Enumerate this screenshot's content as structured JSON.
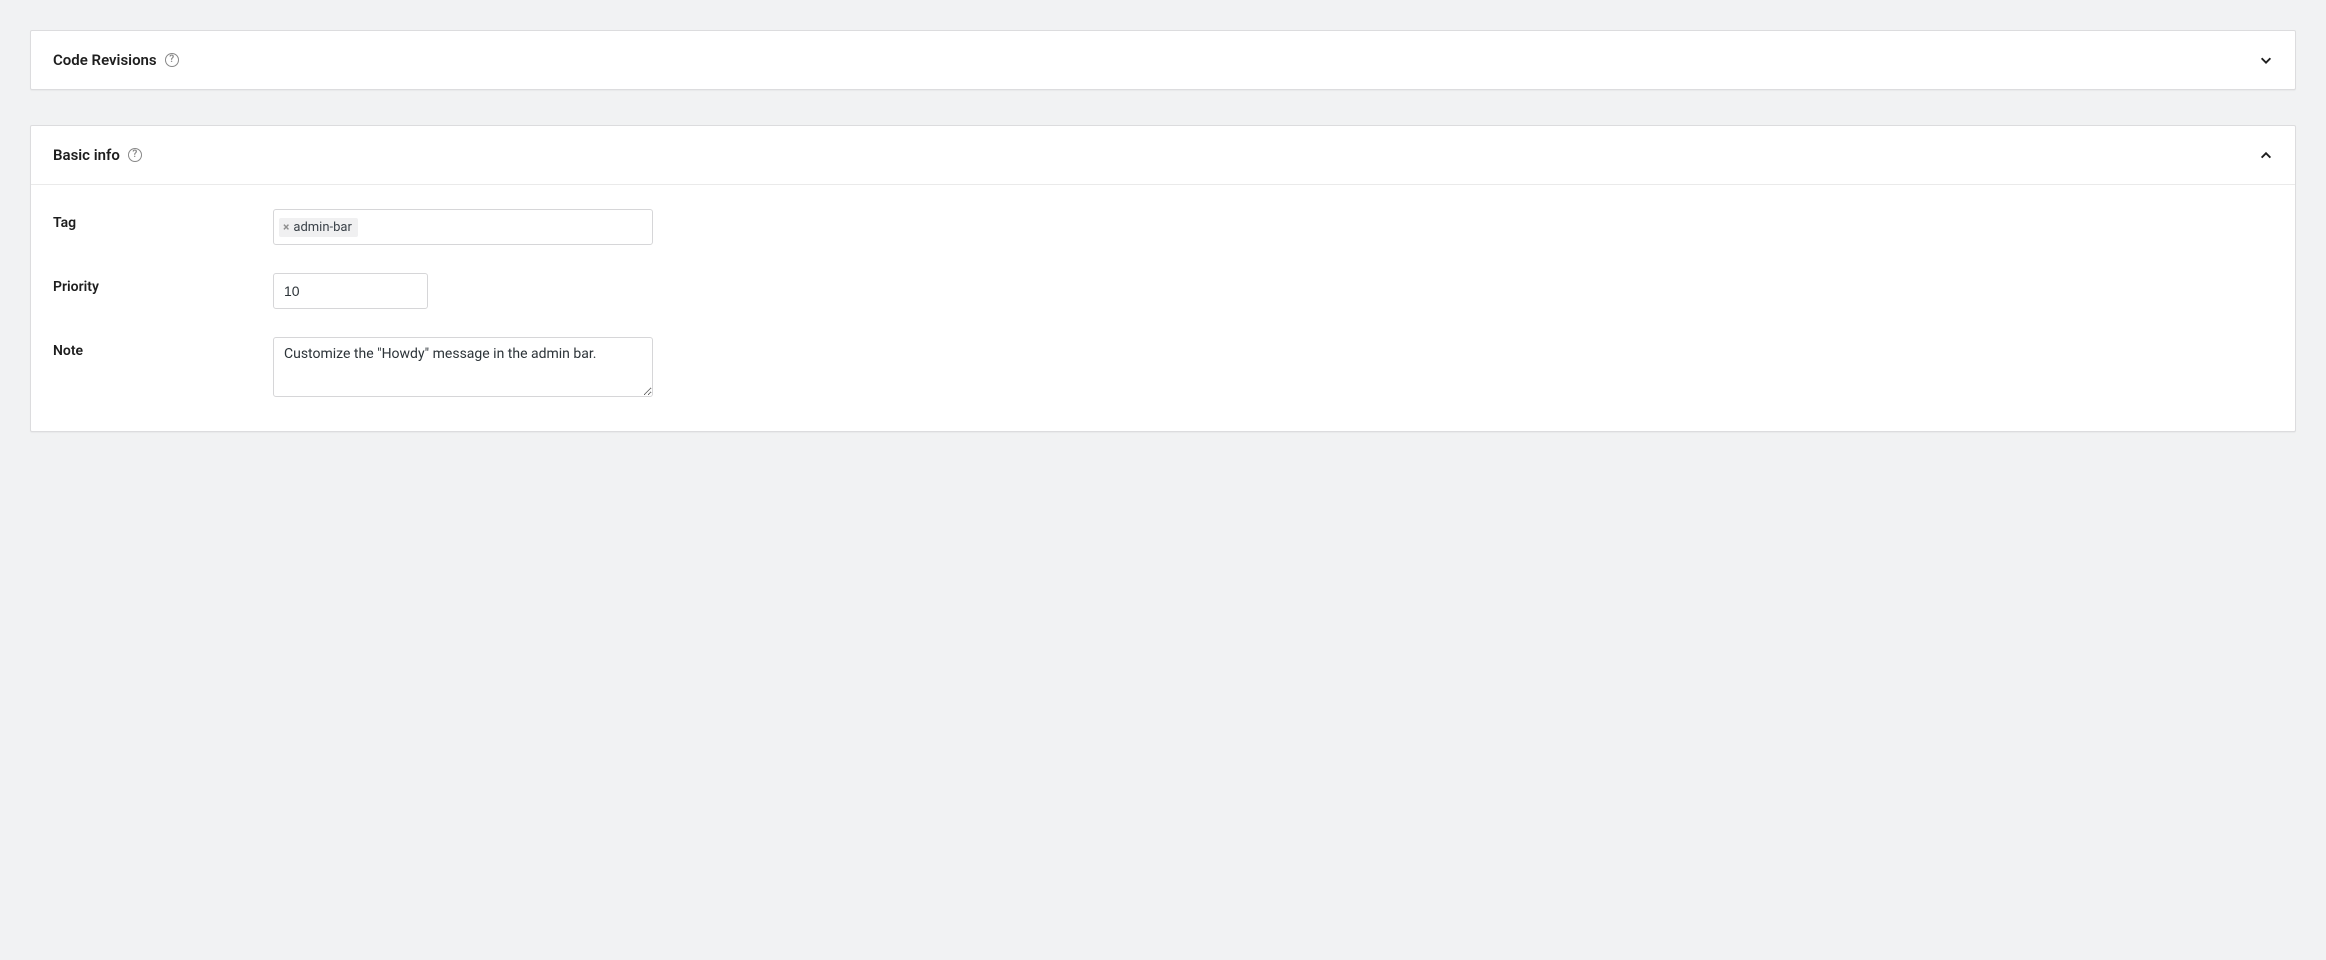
{
  "panels": {
    "code_revisions": {
      "title": "Code Revisions"
    },
    "basic_info": {
      "title": "Basic info",
      "fields": {
        "tag": {
          "label": "Tag",
          "chips": [
            "admin-bar"
          ]
        },
        "priority": {
          "label": "Priority",
          "value": "10"
        },
        "note": {
          "label": "Note",
          "value": "Customize the \"Howdy\" message in the admin bar."
        }
      }
    }
  }
}
